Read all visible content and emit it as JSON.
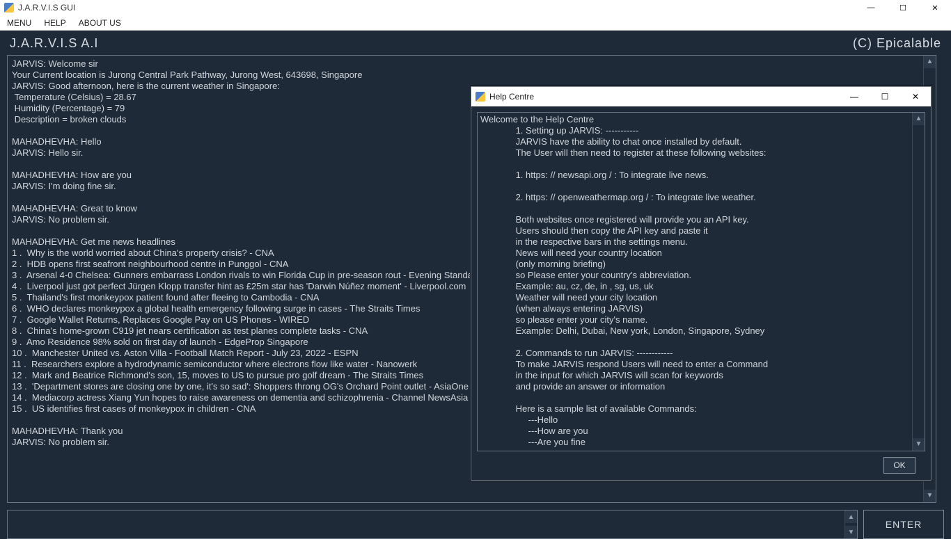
{
  "window": {
    "title": "J.A.R.V.I.S GUI"
  },
  "menu": {
    "items": [
      "MENU",
      "HELP",
      "ABOUT US"
    ]
  },
  "header": {
    "title": "J.A.R.V.I.S  A.I",
    "copyright": "(C) Epicalable"
  },
  "chat_text": "JARVIS: Welcome sir\nYour Current location is Jurong Central Park Pathway, Jurong West, 643698, Singapore\nJARVIS: Good afternoon, here is the current weather in Singapore:\n Temperature (Celsius) = 28.67\n Humidity (Percentage) = 79\n Description = broken clouds\n\nMAHADHEVHA: Hello\nJARVIS: Hello sir.\n\nMAHADHEVHA: How are you\nJARVIS: I'm doing fine sir.\n\nMAHADHEVHA: Great to know\nJARVIS: No problem sir.\n\nMAHADHEVHA: Get me news headlines\n1 .  Why is the world worried about China's property crisis? - CNA\n2 .  HDB opens first seafront neighbourhood centre in Punggol - CNA\n3 .  Arsenal 4-0 Chelsea: Gunners embarrass London rivals to win Florida Cup in pre-season rout - Evening Standar\n4 .  Liverpool just got perfect Jürgen Klopp transfer hint as £25m star has 'Darwin Núñez moment' - Liverpool.com\n5 .  Thailand's first monkeypox patient found after fleeing to Cambodia - CNA\n6 .  WHO declares monkeypox a global health emergency following surge in cases - The Straits Times\n7 .  Google Wallet Returns, Replaces Google Pay on US Phones - WIRED\n8 .  China's home-grown C919 jet nears certification as test planes complete tasks - CNA\n9 .  Amo Residence 98% sold on first day of launch - EdgeProp Singapore\n10 .  Manchester United vs. Aston Villa - Football Match Report - July 23, 2022 - ESPN\n11 .  Researchers explore a hydrodynamic semiconductor where electrons flow like water - Nanowerk\n12 .  Mark and Beatrice Richmond's son, 15, moves to US to pursue pro golf dream - The Straits Times\n13 .  'Department stores are closing one by one, it's so sad': Shoppers throng OG's Orchard Point outlet - AsiaOne\n14 .  Mediacorp actress Xiang Yun hopes to raise awareness on dementia and schizophrenia - Channel NewsAsia\n15 .  US identifies first cases of monkeypox in children - CNA\n\nMAHADHEVHA: Thank you\nJARVIS: No problem sir.",
  "enter_label": "ENTER",
  "help": {
    "title": "Help Centre",
    "ok_label": "OK",
    "body": "Welcome to the Help Centre\n              1. Setting up JARVIS: -----------\n              JARVIS have the ability to chat once installed by default.\n              The User will then need to register at these following websites:\n\n              1. https: // newsapi.org / : To integrate live news.\n\n              2. https: // openweathermap.org / : To integrate live weather.\n\n              Both websites once registered will provide you an API key.\n              Users should then copy the API key and paste it\n              in the respective bars in the settings menu.\n              News will need your country location\n              (only morning briefing)\n              so Please enter your country's abbreviation.\n              Example: au, cz, de, in , sg, us, uk\n              Weather will need your city location\n              (when always entering JARVIS)\n              so please enter your city's name.\n              Example: Delhi, Dubai, New york, London, Singapore, Sydney\n\n              2. Commands to run JARVIS: ------------\n              To make JARVIS respond Users will need to enter a Command\n              in the input for which JARVIS will scan for keywords\n              and provide an answer or information\n\n              Here is a sample list of available Commands:\n                   ---Hello\n                   ---How are you\n                   ---Are you fine"
  }
}
